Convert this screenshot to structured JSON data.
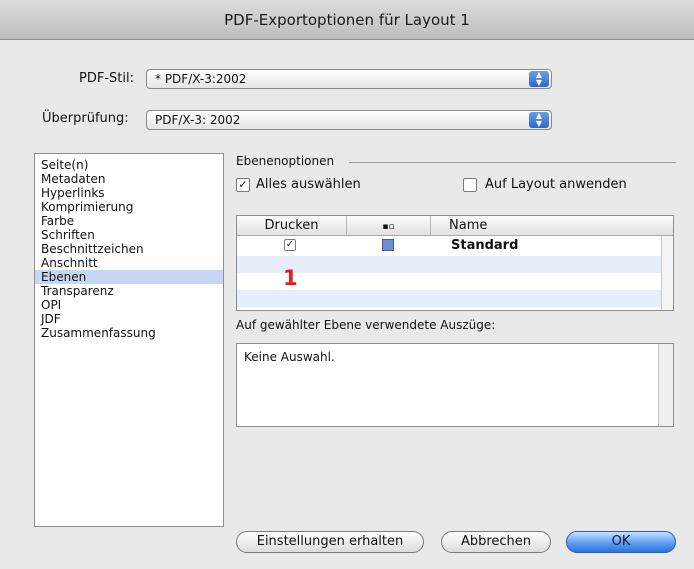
{
  "window": {
    "title": "PDF-Exportoptionen für Layout 1"
  },
  "form": {
    "pdf_style_label": "PDF-Stil:",
    "pdf_style_value": "* PDF/X-3:2002",
    "check_label": "Überprüfung:",
    "check_value": "PDF/X-3: 2002"
  },
  "sidebar": {
    "items": [
      "Seite(n)",
      "Metadaten",
      "Hyperlinks",
      "Komprimierung",
      "Farbe",
      "Schriften",
      "Beschnittzeichen",
      "Anschnitt",
      "Ebenen",
      "Transparenz",
      "OPI",
      "JDF",
      "Zusammenfassung"
    ],
    "selected": "Ebenen"
  },
  "layers": {
    "group_title": "Ebenenoptionen",
    "select_all_label": "Alles auswählen",
    "select_all_checked": true,
    "apply_layout_label": "Auf Layout anwenden",
    "apply_layout_checked": false,
    "table": {
      "headers": [
        "Drucken",
        "",
        "Name"
      ],
      "rows": [
        {
          "print": true,
          "name": "Standard"
        }
      ]
    },
    "annotation": "1"
  },
  "extracts": {
    "label": "Auf gewählter Ebene verwendete Auszüge:",
    "text": "Keine Auswahl."
  },
  "buttons": {
    "keep_settings": "Einstellungen erhalten",
    "cancel": "Abbrechen",
    "ok": "OK"
  },
  "colors": {
    "selection": "#c5d7f3",
    "layer_swatch": "#6e8fcf",
    "annotation": "#e01f1f"
  }
}
